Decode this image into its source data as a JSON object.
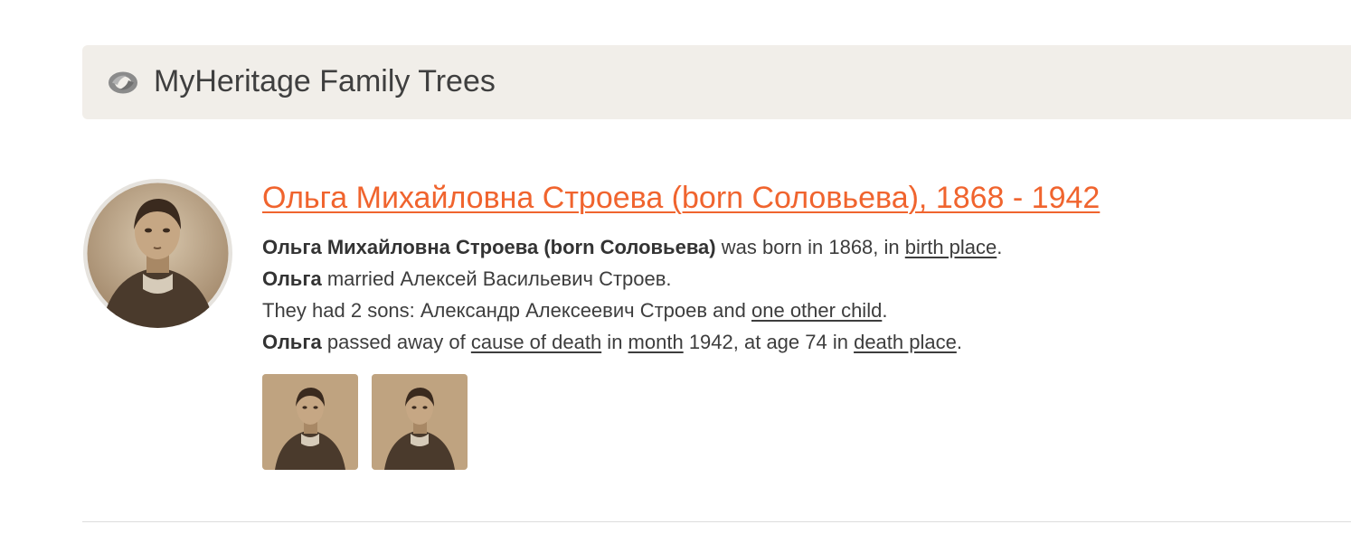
{
  "header": {
    "logo_icon": "myheritage-logo-icon",
    "title": "MyHeritage Family Trees"
  },
  "record": {
    "photo_icon": "person-portrait",
    "title": "Ольга Михайловна Строева (born Соловьева), 1868 - 1942",
    "line1": {
      "name": "Ольга Михайловна Строева (born Соловьева)",
      "text1": " was born in 1868, in ",
      "link": "birth place",
      "end": "."
    },
    "line2": {
      "name": "Ольга",
      "text": " married Алексей Васильевич Строев."
    },
    "line3": {
      "text": "They had 2 sons: Александр Алексеевич Строев and ",
      "link": "one other child",
      "end": "."
    },
    "line4": {
      "name": "Ольга",
      "text1": " passed away of ",
      "link1": "cause of death",
      "text2": " in ",
      "link2": "month",
      "text3": " 1942, at age 74 in ",
      "link3": "death place",
      "end": "."
    },
    "thumbnails": [
      "photo-thumbnail-1",
      "photo-thumbnail-2"
    ]
  },
  "colors": {
    "accent": "#f0642e",
    "header_bg": "#f1eee9",
    "text": "#3d3d3d",
    "sepia": "#b69a78"
  }
}
